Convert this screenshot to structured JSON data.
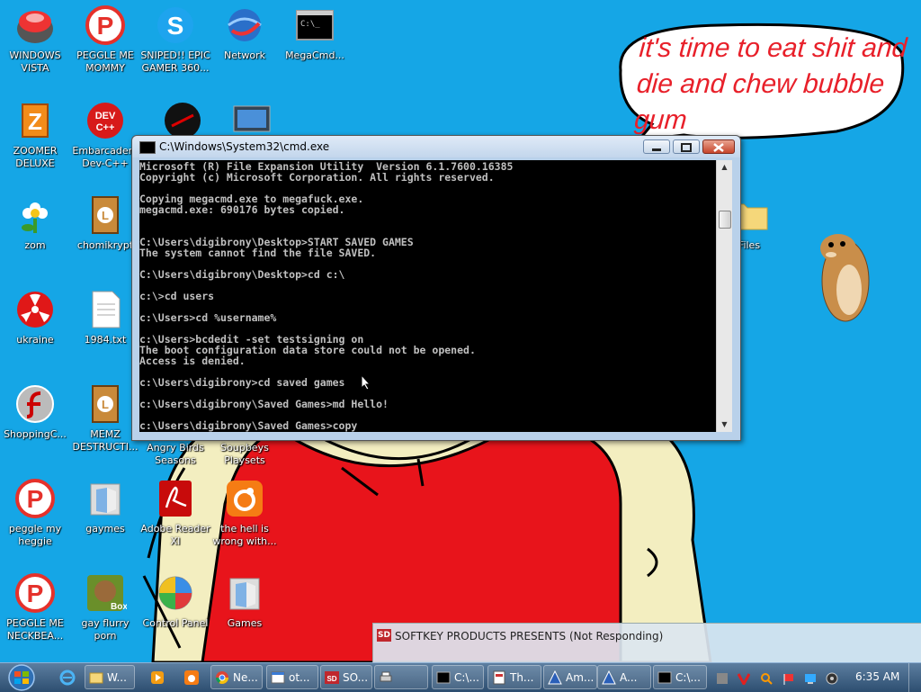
{
  "desktop_icons": [
    {
      "label": "WINDOWS VISTA",
      "icon": "vista-orb-icon"
    },
    {
      "label": "PEGGLE ME MOMMY",
      "icon": "peggle-icon"
    },
    {
      "label": "SNIPED!! EPIC GAMER 360...",
      "icon": "skype-icon"
    },
    {
      "label": "Network",
      "icon": "network-icon"
    },
    {
      "label": "MegaCmd...",
      "icon": "cmd-icon"
    },
    {
      "label": "ZOOMER DELUXE",
      "icon": "zoomer-icon"
    },
    {
      "label": "Embarcadero Dev-C++",
      "icon": "devcpp-icon"
    },
    {
      "label": "zom",
      "icon": "flower-icon"
    },
    {
      "label": "chomikrypt",
      "icon": "winrar-icon"
    },
    {
      "label": "ukraine",
      "icon": "radiation-icon"
    },
    {
      "label": "1984.txt",
      "icon": "text-file-icon"
    },
    {
      "label": "ShoppingC...",
      "icon": "flash-icon"
    },
    {
      "label": "MEMZ DESTRUCTI...",
      "icon": "winrar-icon"
    },
    {
      "label": "Angry Birds Seasons",
      "icon": "angry-birds-icon"
    },
    {
      "label": "Soupbeys Playsets",
      "icon": "folder-icon"
    },
    {
      "label": "peggle my heggie",
      "icon": "peggle-icon"
    },
    {
      "label": "gaymes",
      "icon": "games-folder-icon"
    },
    {
      "label": "Adobe Reader XI",
      "icon": "adobe-reader-icon"
    },
    {
      "label": "the hell is wrong with...",
      "icon": "uc-browser-icon"
    },
    {
      "label": "PEGGLE ME NECKBEA...",
      "icon": "peggle-icon"
    },
    {
      "label": "gay flurry porn",
      "icon": "box-game-icon"
    },
    {
      "label": "Control Panel",
      "icon": "control-panel-icon"
    },
    {
      "label": "Games",
      "icon": "games-folder-icon"
    },
    {
      "label": "Files",
      "icon": "folder-icon"
    }
  ],
  "speech_bubble": {
    "text": "it's time to eat shit and die and chew bubble gum"
  },
  "cmd_window": {
    "title": "C:\\Windows\\System32\\cmd.exe",
    "lines": "Microsoft (R) File Expansion Utility  Version 6.1.7600.16385\nCopyright (c) Microsoft Corporation. All rights reserved.\n\nCopying megacmd.exe to megafuck.exe.\nmegacmd.exe: 690176 bytes copied.\n\n\nC:\\Users\\digibrony\\Desktop>START SAVED GAMES\nThe system cannot find the file SAVED.\n\nC:\\Users\\digibrony\\Desktop>cd c:\\\n\nc:\\>cd users\n\nc:\\Users>cd %username%\n\nc:\\Users>bcdedit -set testsigning on\nThe boot configuration data store could not be opened.\nAccess is denied.\n\nc:\\Users\\digibrony>cd saved games\n\nc:\\Users\\digibrony\\Saved Games>md Hello!\n\nc:\\Users\\digibrony\\Saved Games>copy"
  },
  "not_responding_window": {
    "title": "SOFTKEY PRODUCTS PRESENTS (Not Responding)"
  },
  "taskbar": {
    "buttons": [
      {
        "label": "W...",
        "icon": "explorer-icon"
      },
      {
        "label": "Ne...",
        "icon": "chrome-icon"
      },
      {
        "label": "ot...",
        "icon": "window-icon"
      },
      {
        "label": "SO...",
        "icon": "softkey-icon"
      },
      {
        "label": "",
        "icon": "printer-icon"
      },
      {
        "label": "C:\\...",
        "icon": "cmd-icon"
      },
      {
        "label": "Th...",
        "icon": "app-icon"
      },
      {
        "label": "Am...",
        "icon": "triangle-app-icon"
      },
      {
        "label": "A...",
        "icon": "triangle-app-icon"
      },
      {
        "label": "C:\\...",
        "icon": "cmd-icon"
      }
    ],
    "clock": "6:35 AM"
  }
}
